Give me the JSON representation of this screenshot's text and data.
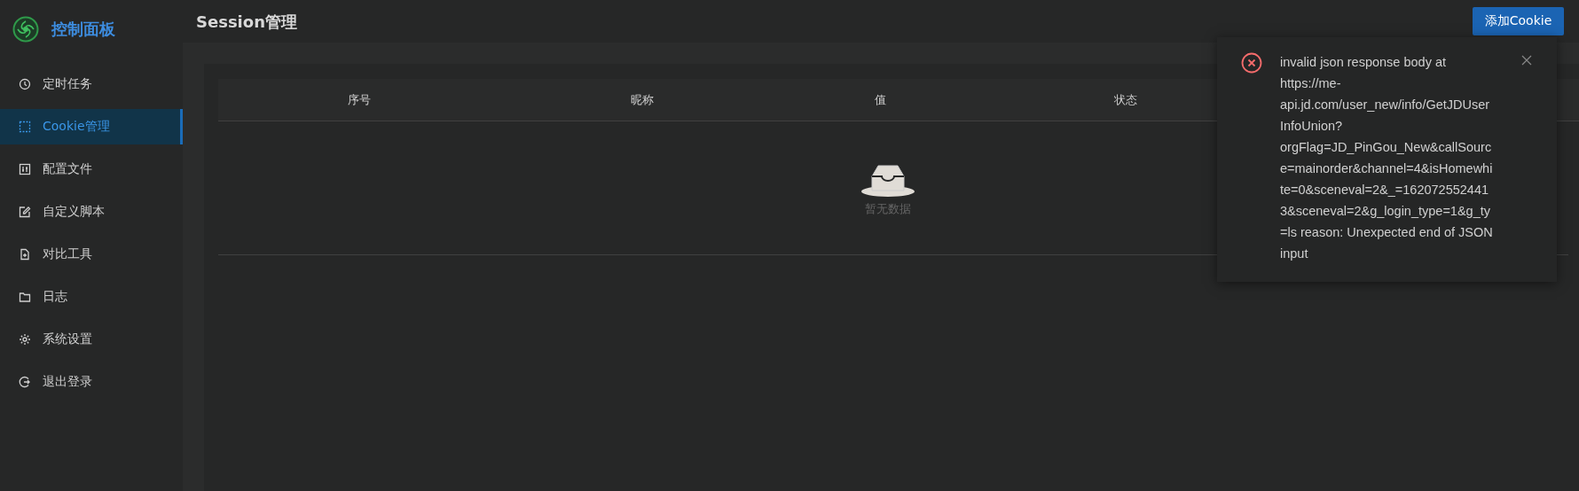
{
  "sidebar": {
    "title": "控制面板",
    "items": [
      {
        "label": "定时任务",
        "selected": false
      },
      {
        "label": "Cookie管理",
        "selected": true
      },
      {
        "label": "配置文件",
        "selected": false
      },
      {
        "label": "自定义脚本",
        "selected": false
      },
      {
        "label": "对比工具",
        "selected": false
      },
      {
        "label": "日志",
        "selected": false
      },
      {
        "label": "系统设置",
        "selected": false
      },
      {
        "label": "退出登录",
        "selected": false
      }
    ]
  },
  "header": {
    "title": "Session管理",
    "button": "添加Cookie"
  },
  "table": {
    "columns": [
      "序号",
      "昵称",
      "值",
      "状态"
    ],
    "empty_text": "暂无数据"
  },
  "notification": {
    "kind": "error",
    "message": "invalid json response body at https://me-api.jd.com/user_new/info/GetJDUserInfoUnion?orgFlag=JD_PinGou_New&callSource=mainorder&channel=4&isHomewhite=0&sceneval=2&_=1620725524413&sceneval=2&g_login_type=1&g_ty=ls reason: Unexpected end of JSON input"
  }
}
